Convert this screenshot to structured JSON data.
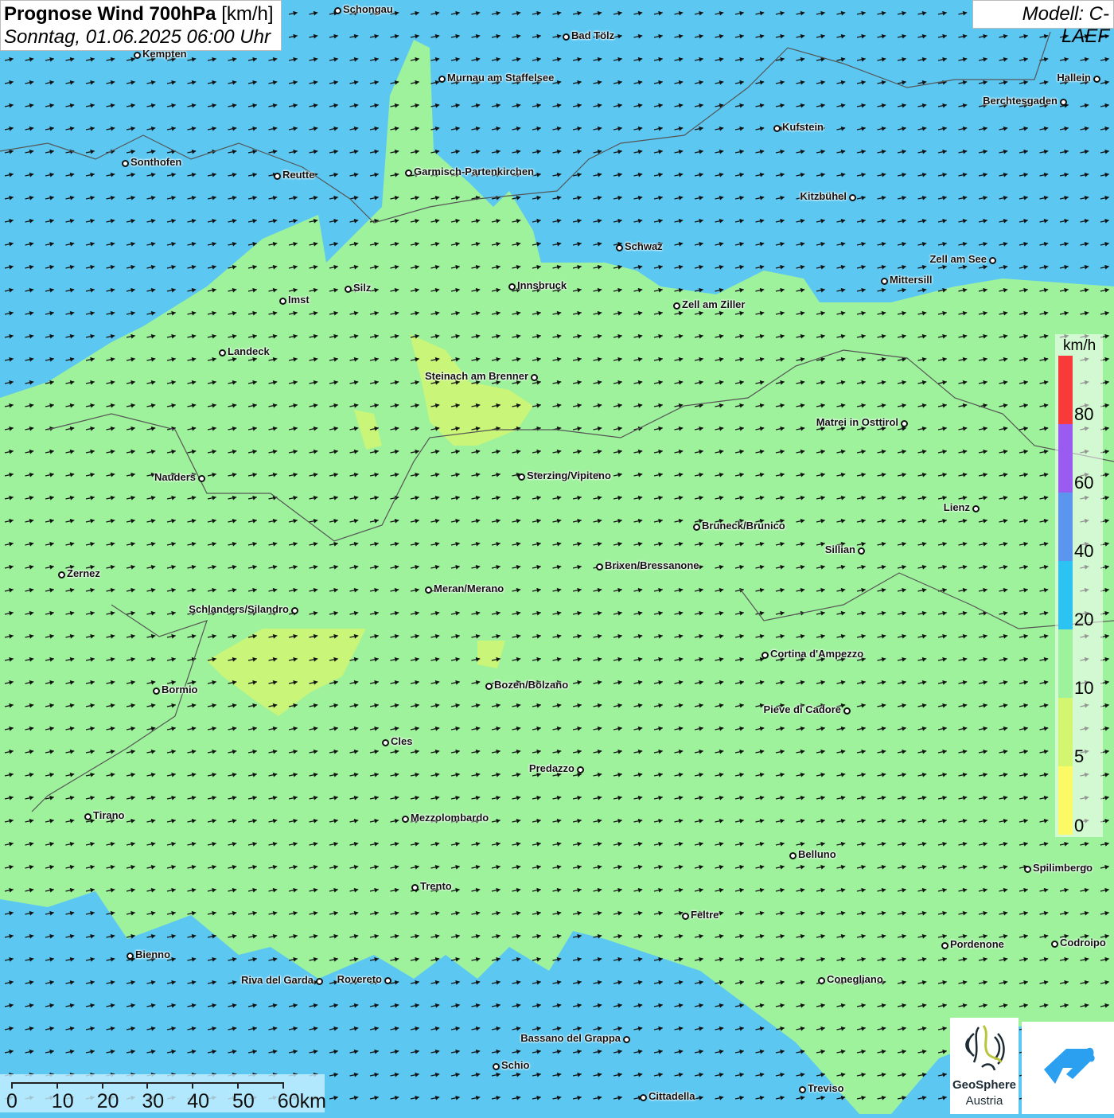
{
  "header": {
    "title_bold": "Prognose Wind 700hPa",
    "title_unit": "[km/h]",
    "subtitle": "Sonntag, 01.06.2025 06:00 Uhr"
  },
  "model_label": "Modell: C-LAEF",
  "legend": {
    "unit": "km/h",
    "ticks": [
      "80",
      "60",
      "40",
      "20",
      "10",
      "5",
      "0"
    ],
    "colors": [
      "#f83a3a",
      "#9a5cf0",
      "#5b95ee",
      "#2cc3f2",
      "#9ef29c",
      "#d3f570",
      "#fbf966"
    ]
  },
  "scale_bar": {
    "labels": [
      "0",
      "10",
      "20",
      "30",
      "40",
      "50",
      "60km"
    ]
  },
  "logos": {
    "geosphere_line1": "GeoSphere",
    "geosphere_line2": "Austria"
  },
  "cities": [
    "Schongau",
    "Bad Tölz",
    "Kempten",
    "Murnau am Staffelsee",
    "Hallein",
    "Berchtesgaden",
    "Kufstein",
    "Sonthofen",
    "Reutte",
    "Garmisch-Partenkirchen",
    "Kitzbühel",
    "Schwaz",
    "Zell am See",
    "Mittersill",
    "Imst",
    "Silz",
    "Innsbruck",
    "Zell am Ziller",
    "Landeck",
    "Steinach am Brenner",
    "Matrei in Osttirol",
    "Nauders",
    "Sterzing/Vipiteno",
    "Lienz",
    "Bruneck/Brunico",
    "Sillian",
    "Zernez",
    "Brixen/Bressanone",
    "Meran/Merano",
    "Schlanders/Silandro",
    "Cortina d'Ampezzo",
    "Bormio",
    "Bozen/Bolzano",
    "Pieve di Cadore",
    "Cles",
    "Predazzo",
    "Tirano",
    "Mezzolombardo",
    "Belluno",
    "Spilimbergo",
    "Trento",
    "Feltre",
    "Bienno",
    "Pordenone",
    "Codroipo",
    "Riva del Garda",
    "Rovereto",
    "Conegliano",
    "Bassano del Grappa",
    "Schio",
    "Treviso",
    "Cittadella"
  ]
}
